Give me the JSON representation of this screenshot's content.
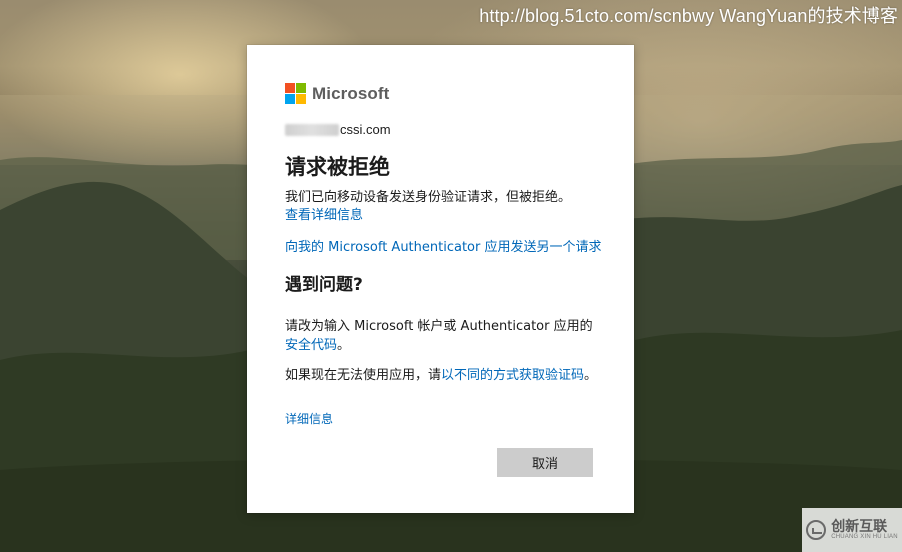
{
  "watermark": "http://blog.51cto.com/scnbwy WangYuan的技术博客",
  "dialog": {
    "brand": "Microsoft",
    "account_suffix": "cssi.com",
    "title": "请求被拒绝",
    "message": "我们已向移动设备发送身份验证请求，但被拒绝。",
    "view_details_link": "查看详细信息",
    "resend_link": "向我的 Microsoft Authenticator 应用发送另一个请求",
    "problem_heading": "遇到问题?",
    "para1_text": "请改为输入 Microsoft 帐户或 Authenticator 应用的",
    "para1_link": "安全代码",
    "para1_end": "。",
    "para2_text": "如果现在无法使用应用，请",
    "para2_link": "以不同的方式获取验证码",
    "para2_end": "。",
    "details_link": "详细信息",
    "cancel_label": "取消"
  },
  "badge": {
    "name": "创新互联",
    "sub": "CHUANG XIN HU LIAN"
  },
  "colors": {
    "link": "#0067b8",
    "button_bg": "#cccccc",
    "ms_red": "#f25022",
    "ms_green": "#7fba00",
    "ms_blue": "#00a4ef",
    "ms_yellow": "#ffb900"
  }
}
